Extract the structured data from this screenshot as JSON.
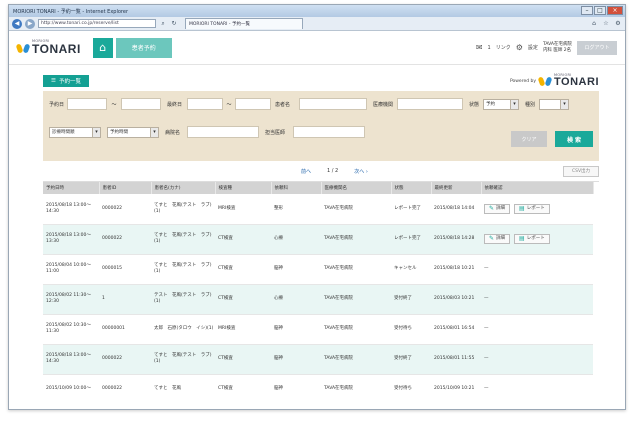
{
  "window": {
    "title": "MORIORI TONARI - 予約一覧 - Internet Explorer"
  },
  "browser": {
    "url": "http://www.tonari.co.jp/reserve/list",
    "tab": "MORIORI TONARI - 予約一覧",
    "back": "◀",
    "forward": "▶"
  },
  "header": {
    "logo_small": "MORIORI",
    "logo_big": "TONARI",
    "home_icon": "home-icon",
    "tab_label": "患者予約",
    "notify": "1",
    "help": "リンク",
    "settings": "設定",
    "user_line1": "TAVA在宅病院",
    "user_line2": "内科  医師  2名",
    "logout": "ログアウト"
  },
  "page": {
    "label": "予約一覧",
    "powered_by": "Powered by"
  },
  "search": {
    "date_label": "予約日",
    "date_sep": "〜",
    "update_label": "最終日",
    "update_sep": "〜",
    "patient_name_label": "患者名",
    "doctor_label": "医療機関",
    "status_label": "状態",
    "status_value": "予約",
    "type_label": "種別",
    "type_value": "",
    "sort_value": "診療時間順",
    "order_value": "予約時間",
    "hospital_label": "病院名",
    "dept_label": "担当医師",
    "clear_button": "クリア",
    "search_button": "検 索"
  },
  "pager": {
    "prev": "前へ",
    "page": "1 / 2",
    "next": "次へ ›",
    "csv_button": "CSV出力"
  },
  "table": {
    "headers": [
      "予約日時",
      "患者ID",
      "患者名(カナ)",
      "検査種",
      "依頼科",
      "医療機関名",
      "状態",
      "最終更新",
      "依頼確認"
    ],
    "rows": [
      {
        "date": "2015/08/18 13:00〜 14:30",
        "id": "0000022",
        "name": "てすと　花風(テスト　ラブ)(1)",
        "exam": "MRI検査",
        "dept": "整形",
        "hosp": "TAVA在宅病院",
        "status": "レポート完了",
        "updated": "2015/08/18 14:04",
        "actions": [
          "詳細",
          "レポート"
        ]
      },
      {
        "date": "2015/08/18 13:00〜 13:30",
        "id": "0000022",
        "name": "てすと　花風(テスト　ラブ)(1)",
        "exam": "CT検査",
        "dept": "心療",
        "hosp": "TAVA在宅病院",
        "status": "レポート完了",
        "updated": "2015/08/18 14:28",
        "actions": [
          "詳細",
          "レポート"
        ]
      },
      {
        "date": "2015/08/04 10:00〜 11:00",
        "id": "0000015",
        "name": "てすと　花風(テスト　ラブ)(1)",
        "exam": "CT検査",
        "dept": "脳神",
        "hosp": "TAVA在宅病院",
        "status": "キャンセル",
        "updated": "2015/08/18 10:21",
        "actions": [
          "—"
        ]
      },
      {
        "date": "2015/08/02 11:30〜 12:30",
        "id": "1",
        "name": "テスト　花風(テスト　ラブ)(1)",
        "exam": "CT検査",
        "dept": "心療",
        "hosp": "TAVA在宅病院",
        "status": "受付終了",
        "updated": "2015/08/03 10:21",
        "actions": [
          "—"
        ]
      },
      {
        "date": "2015/08/02 10:30〜 11:30",
        "id": "00000001",
        "name": "太郎　石原(タロウ　イシ)(1)",
        "exam": "MRI検査",
        "dept": "脳神",
        "hosp": "TAVA在宅病院",
        "status": "受付待ち",
        "updated": "2015/08/01 16:54",
        "actions": [
          "—"
        ]
      },
      {
        "date": "2015/08/18 13:00〜 14:30",
        "id": "0000022",
        "name": "てすと　花風(テスト　ラブ)(1)",
        "exam": "CT検査",
        "dept": "脳神",
        "hosp": "TAVA在宅病院",
        "status": "受付終了",
        "updated": "2015/08/01 11:55",
        "actions": [
          "—"
        ]
      },
      {
        "date": "2015/10/09 10:00〜",
        "id": "0000022",
        "name": "てすと　花風",
        "exam": "CT検査",
        "dept": "脳神",
        "hosp": "TAVA在宅病院",
        "status": "受付待ち",
        "updated": "2015/10/09 10:21",
        "actions": [
          "—"
        ]
      }
    ]
  }
}
